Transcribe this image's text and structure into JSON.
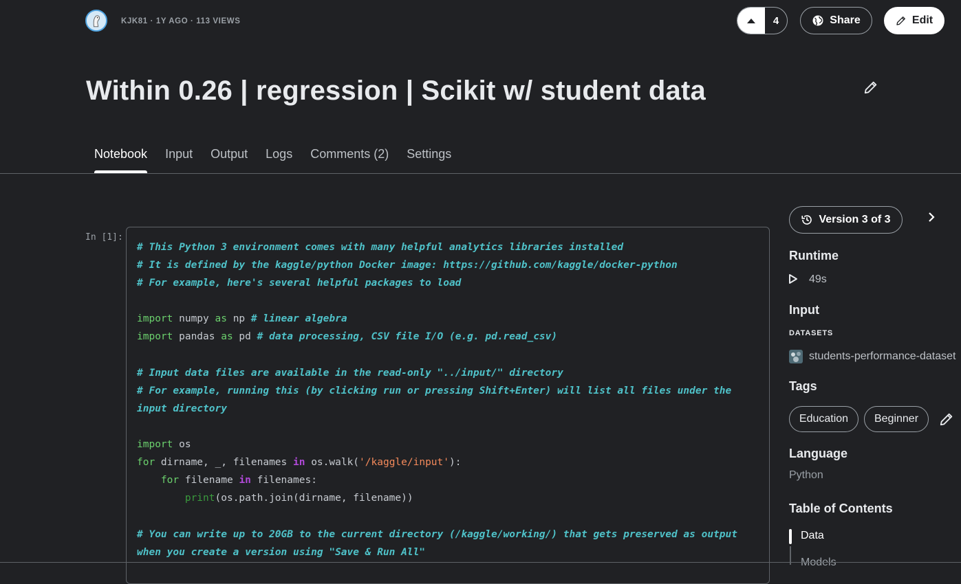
{
  "header": {
    "author": "KJK81",
    "age": "1Y AGO",
    "views": "113 VIEWS",
    "meta_text": "KJK81 · 1Y AGO · 113 VIEWS",
    "vote_count": "4",
    "share_label": "Share",
    "edit_label": "Edit"
  },
  "title": "Within 0.26 | regression | Scikit w/ student data",
  "tabs": [
    {
      "label": "Notebook",
      "active": true
    },
    {
      "label": "Input",
      "active": false
    },
    {
      "label": "Output",
      "active": false
    },
    {
      "label": "Logs",
      "active": false
    },
    {
      "label": "Comments (2)",
      "active": false
    },
    {
      "label": "Settings",
      "active": false
    }
  ],
  "cell": {
    "prompt": "In [1]:",
    "code_lines": [
      "# This Python 3 environment comes with many helpful analytics libraries installed",
      "# It is defined by the kaggle/python Docker image: https://github.com/kaggle/docker-python",
      "# For example, here's several helpful packages to load",
      "",
      "import numpy as np # linear algebra",
      "import pandas as pd # data processing, CSV file I/O (e.g. pd.read_csv)",
      "",
      "# Input data files are available in the read-only \"../input/\" directory",
      "# For example, running this (by clicking run or pressing Shift+Enter) will list all files under the",
      "input directory",
      "",
      "import os",
      "for dirname, _, filenames in os.walk('/kaggle/input'):",
      "    for filename in filenames:",
      "        print(os.path.join(dirname, filename))",
      "",
      "# You can write up to 20GB to the current directory (/kaggle/working/) that gets preserved as output",
      "when you create a version using \"Save & Run All\""
    ]
  },
  "sidebar": {
    "version_label": "Version 3 of 3",
    "runtime_heading": "Runtime",
    "runtime_value": "49s",
    "input_heading": "Input",
    "datasets_label": "DATASETS",
    "dataset_name": "students-performance-dataset",
    "tags_heading": "Tags",
    "tags": [
      "Education",
      "Beginner"
    ],
    "language_heading": "Language",
    "language_value": "Python",
    "toc_heading": "Table of Contents",
    "toc_items": [
      "Data",
      "Models"
    ]
  },
  "colors": {
    "background": "#202124",
    "comment": "#4fc2c9",
    "keyword": "#6bd06d",
    "in_keyword": "#b049d8",
    "string": "#f48a5b",
    "builtin": "#3a9b3d"
  },
  "icons": [
    "avatar",
    "upvote-arrow-icon",
    "globe-icon",
    "pencil-icon",
    "history-icon",
    "chevron-right-icon",
    "play-icon",
    "dataset-thumbnail-icon"
  ]
}
